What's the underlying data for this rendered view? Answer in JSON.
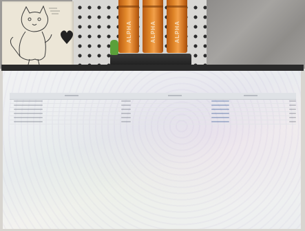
{
  "scene": {
    "cans_brand": "ALPHA",
    "colors": {
      "can_orange": "#e08628",
      "pegboard": "#d9d8d5",
      "screen": "#eef0f2",
      "link_blue": "#5a77a8"
    },
    "table": {
      "headers": [
        "",
        "",
        ""
      ],
      "rows": [
        [
          "",
          "",
          "",
          ""
        ],
        [
          "",
          "",
          "",
          ""
        ],
        [
          "",
          "",
          "",
          ""
        ],
        [
          "",
          "",
          "",
          ""
        ],
        [
          "",
          "",
          "",
          ""
        ],
        [
          "",
          "",
          "",
          ""
        ]
      ]
    }
  }
}
